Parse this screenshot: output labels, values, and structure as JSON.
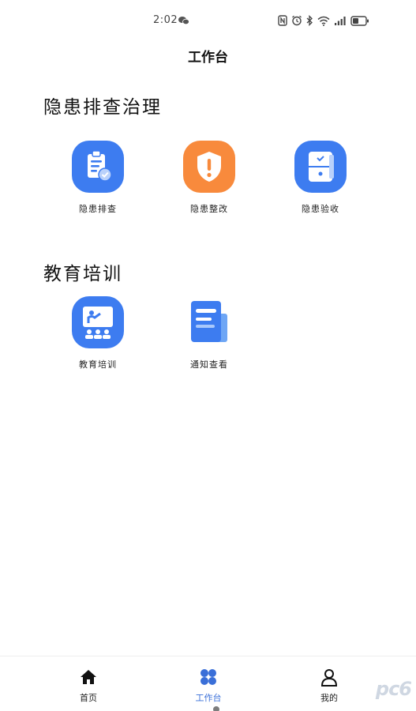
{
  "status_bar": {
    "time": "2:02"
  },
  "header": {
    "title": "工作台"
  },
  "sections": [
    {
      "title": "隐患排查治理",
      "items": [
        {
          "label": "隐患排查",
          "icon": "clipboard-check-icon"
        },
        {
          "label": "隐患整改",
          "icon": "shield-alert-icon"
        },
        {
          "label": "隐患验收",
          "icon": "cabinet-check-icon"
        }
      ]
    },
    {
      "title": "教育培训",
      "items": [
        {
          "label": "教育培训",
          "icon": "classroom-icon"
        },
        {
          "label": "通知查看",
          "icon": "notice-card-icon"
        }
      ]
    }
  ],
  "bottom_nav": {
    "items": [
      {
        "label": "首页",
        "icon": "home-icon"
      },
      {
        "label": "工作台",
        "icon": "workbench-icon",
        "active": true
      },
      {
        "label": "我的",
        "icon": "user-icon"
      }
    ]
  },
  "watermark": "pc6",
  "colors": {
    "accent_blue": "#3d7cf0",
    "accent_orange": "#f88a3c",
    "nav_active": "#3a6fd8"
  }
}
